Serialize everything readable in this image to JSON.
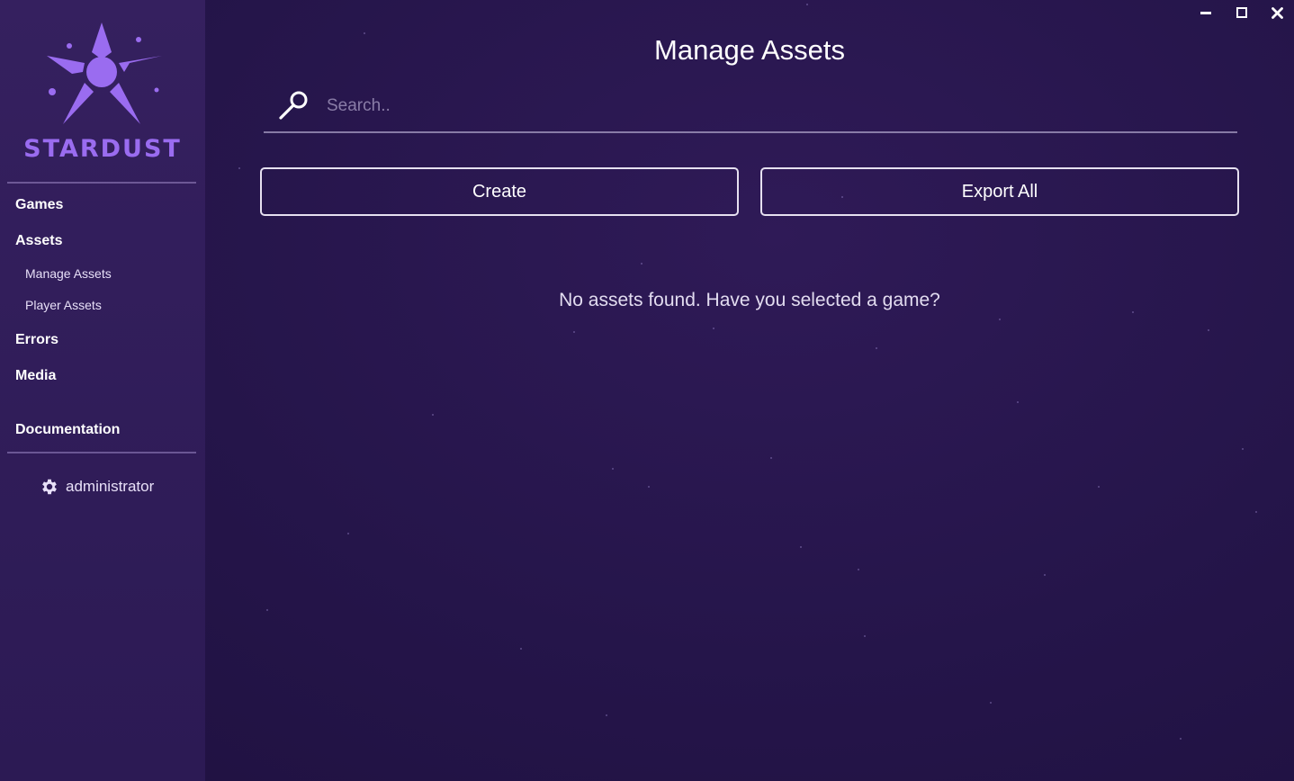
{
  "brand": {
    "name": "STARDUST",
    "color": "#9a6cf0"
  },
  "window_controls": [
    "minimize-icon",
    "maximize-icon",
    "close-icon"
  ],
  "sidebar": {
    "nav": {
      "games": "Games",
      "assets": "Assets",
      "manage_assets": "Manage Assets",
      "player_assets": "Player Assets",
      "errors": "Errors",
      "media": "Media",
      "documentation": "Documentation"
    },
    "user": {
      "icon": "gear-icon",
      "name": "administrator"
    }
  },
  "main": {
    "title": "Manage Assets",
    "search": {
      "icon": "search-icon",
      "placeholder": "Search..",
      "value": ""
    },
    "buttons": {
      "create": "Create",
      "export_all": "Export All"
    },
    "empty_message": "No assets found. Have you selected a game?"
  },
  "colors": {
    "background": "#25154a",
    "sidebar": "#311d5a",
    "accent": "#9a6cf0",
    "text": "#ffffff"
  }
}
